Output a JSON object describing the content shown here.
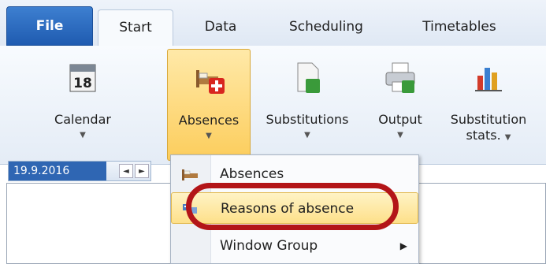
{
  "tabs": [
    "File",
    "Start",
    "Data",
    "Scheduling",
    "Timetables"
  ],
  "ribbon": {
    "calendar": "Calendar",
    "absences": "Absences",
    "substitutions": "Substitutions",
    "output": "Output",
    "stats_line1": "Substitution",
    "stats_line2": "stats."
  },
  "date_nav": {
    "date": "19.9.2016",
    "prev": "◄",
    "next": "►"
  },
  "dropdown": {
    "items": [
      {
        "label": "Absences",
        "icon": "bed-icon"
      },
      {
        "label": "Reasons of absence",
        "icon": "reasons-icon"
      },
      {
        "label": "Window Group",
        "icon": "",
        "submenu_arrow": "▶"
      }
    ]
  },
  "colors": {
    "file_tab": "#1f5bb0",
    "highlight_ring": "#b31518",
    "hover": "#fde08a"
  }
}
